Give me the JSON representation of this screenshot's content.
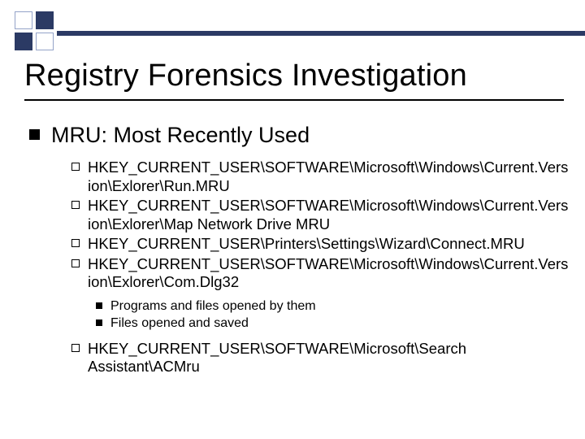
{
  "title": "Registry Forensics Investigation",
  "heading": "MRU: Most Recently Used",
  "paths": {
    "p1": "HKEY_CURRENT_USER\\SOFTWARE\\Microsoft\\Windows\\Current.Version\\Exlorer\\Run.MRU",
    "p2": "HKEY_CURRENT_USER\\SOFTWARE\\Microsoft\\Windows\\Current.Version\\Exlorer\\Map Network Drive MRU",
    "p3": "HKEY_CURRENT_USER\\Printers\\Settings\\Wizard\\Connect.MRU",
    "p4": "HKEY_CURRENT_USER\\SOFTWARE\\Microsoft\\Windows\\Current.Version\\Exlorer\\Com.Dlg32",
    "p5": "HKEY_CURRENT_USER\\SOFTWARE\\Microsoft\\Search Assistant\\ACMru"
  },
  "sub": {
    "s1": "Programs and files opened by them",
    "s2": "Files opened and saved"
  }
}
